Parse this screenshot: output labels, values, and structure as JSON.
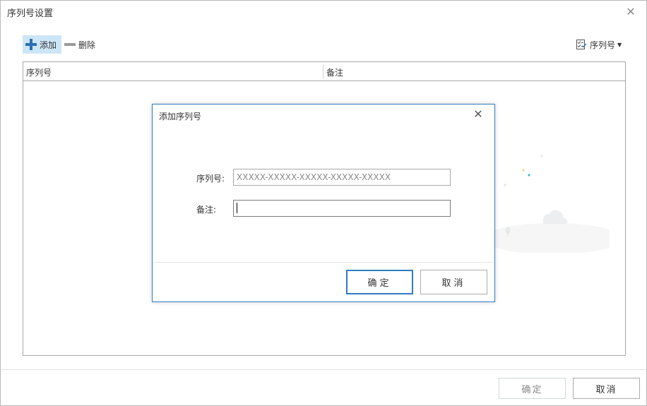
{
  "window": {
    "title": "序列号设置",
    "close_icon": "close-icon"
  },
  "toolbar": {
    "add_label": "添加",
    "delete_label": "删除",
    "serial_menu_label": "序列号"
  },
  "table": {
    "columns": [
      "序列号",
      "备注"
    ],
    "rows": []
  },
  "dialog": {
    "title": "添加序列号",
    "serial_label": "序列号:",
    "serial_placeholder": "XXXXX-XXXXX-XXXXX-XXXXX-XXXXX",
    "note_label": "备注:",
    "note_value": "",
    "ok_label": "确定",
    "cancel_label": "取消"
  },
  "footer": {
    "ok_label": "确定",
    "cancel_label": "取消"
  },
  "colors": {
    "accent": "#2f7bc4",
    "add_button_bg": "#cde6f7",
    "add_icon": "#2a6fb5"
  }
}
